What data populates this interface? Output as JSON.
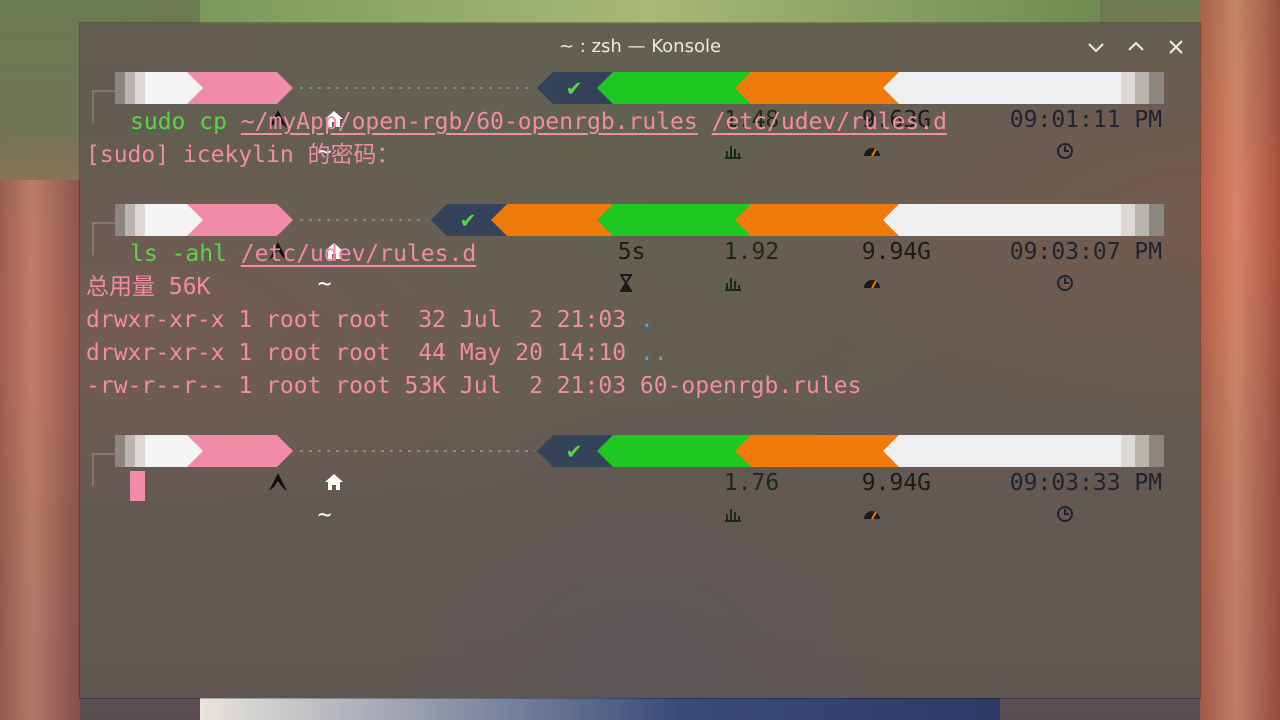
{
  "window": {
    "title": "~ : zsh — Konsole",
    "icons": [
      "minimize-icon",
      "maximize-icon",
      "close-icon"
    ]
  },
  "prompts": [
    {
      "os_icon": "arch-linux-icon",
      "dir_icon": "home-icon",
      "dir": "~",
      "status": "✔",
      "duration": "",
      "load": "1.48",
      "memory": "9.63G",
      "time": "09:01:11 PM"
    },
    {
      "os_icon": "arch-linux-icon",
      "dir_icon": "home-icon",
      "dir": "~",
      "status": "✔",
      "duration": "5s",
      "load": "1.92",
      "memory": "9.94G",
      "time": "09:03:07 PM"
    },
    {
      "os_icon": "arch-linux-icon",
      "dir_icon": "home-icon",
      "dir": "~",
      "status": "✔",
      "duration": "",
      "load": "1.76",
      "memory": "9.94G",
      "time": "09:03:33 PM"
    }
  ],
  "commands": {
    "c1": {
      "cmd": "sudo cp",
      "arg1": "~/myApp/open-rgb/60-openrgb.rules",
      "arg2": "/etc/udev/rules.d"
    },
    "sudo_prompt": "[sudo] icekylin 的密码：",
    "c2": {
      "cmd": "ls -ahl",
      "arg1": "/etc/udev/rules.d"
    }
  },
  "ls_output": {
    "total": "总用量 56K",
    "rows": [
      {
        "meta": "drwxr-xr-x 1 root root  32 Jul  2 21:03 ",
        "name": "."
      },
      {
        "meta": "drwxr-xr-x 1 root root  44 May 20 14:10 ",
        "name": ".."
      },
      {
        "meta": "-rw-r--r-- 1 root root 53K Jul  2 21:03 ",
        "name": "60-openrgb.rules"
      }
    ]
  },
  "colors": {
    "accent_pink": "#f08ca8",
    "ok_green": "#5ad54a",
    "load_green": "#1ec822",
    "memory_orange": "#f07a0a",
    "status_navy": "#34425a",
    "time_bg": "#eef0f2",
    "link_blue": "#4ba3e8"
  }
}
